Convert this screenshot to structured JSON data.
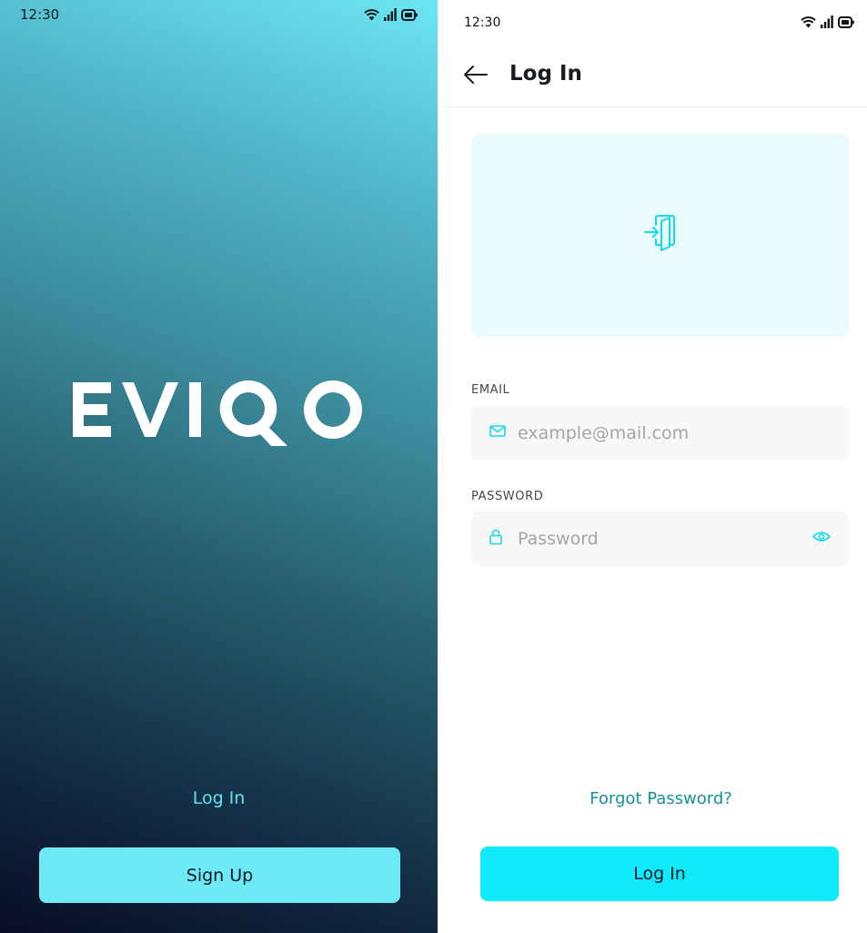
{
  "splash": {
    "status_time": "12:30",
    "brand": "EVIQO",
    "login_link": "Log In",
    "signup_button": "Sign Up"
  },
  "login": {
    "status_time": "12:30",
    "title": "Log In",
    "hero_icon": "login-door-icon",
    "email": {
      "label": "EMAIL",
      "placeholder": "example@mail.com",
      "value": ""
    },
    "password": {
      "label": "PASSWORD",
      "placeholder": "Password",
      "value": ""
    },
    "forgot_link": "Forgot Password?",
    "submit_button": "Log In"
  },
  "colors": {
    "accent": "#0eeafc",
    "signup_button": "#6ee9f8",
    "link_teal": "#16919c",
    "hero_bg": "#e9fbfd"
  }
}
